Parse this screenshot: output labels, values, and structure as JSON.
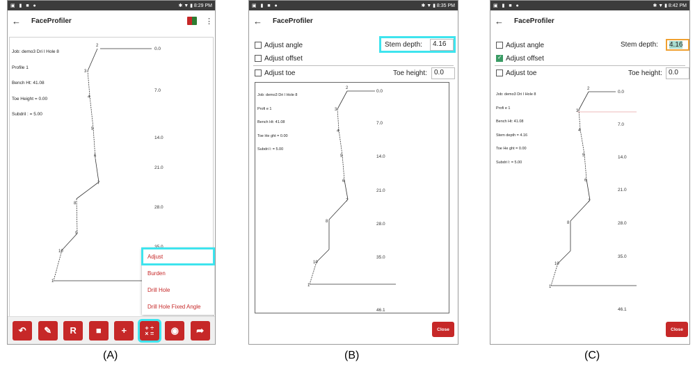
{
  "panels": [
    {
      "id": "A",
      "caption": "(A)",
      "status_time": "8:29 PM",
      "app_title": "FaceProfiler",
      "info_lines": [
        "Job: demo3 Dri l Hole 8",
        "Profile 1",
        "Bench Ht: 41.08",
        "Toe Height = 0.00",
        "Subdril : = 5.00"
      ],
      "depth_labels": [
        "0.0",
        "7.0",
        "14.0",
        "21.0",
        "28.0",
        "35.0"
      ],
      "point_labels": [
        "2",
        "3",
        "4",
        "5",
        "6",
        "7",
        "8",
        "9",
        "10",
        "1"
      ],
      "menu_items": [
        "Adjust",
        "Burden",
        "Drill Hole",
        "Drill Hole Fixed Angle"
      ],
      "toolbar": [
        "undo",
        "pencil",
        "R",
        "trash",
        "plus",
        "calculator",
        "camera",
        "share"
      ]
    },
    {
      "id": "B",
      "caption": "(B)",
      "status_time": "8:35 PM",
      "app_title": "FaceProfiler",
      "adjust_angle": "Adjust angle",
      "adjust_offset": "Adjust offset",
      "adjust_toe": "Adjust toe",
      "stem_depth_label": "Stem depth:",
      "stem_depth_value": "4.16",
      "toe_height_label": "Toe height:",
      "toe_height_value": "0.0",
      "offset_checked": false,
      "info_lines": [
        "Job: demo3 Dri l Hole 8",
        "Profi e 1",
        "Bench Ht: 41.08",
        "Toe He ght = 0.00",
        "Subdri l: = 5.00"
      ],
      "depth_labels": [
        "0.0",
        "7.0",
        "14.0",
        "21.0",
        "28.0",
        "35.0",
        "46.1"
      ],
      "close_label": "Close"
    },
    {
      "id": "C",
      "caption": "(C)",
      "status_time": "8:42 PM",
      "app_title": "FaceProfiler",
      "adjust_angle": "Adjust angle",
      "adjust_offset": "Adjust offset",
      "adjust_toe": "Adjust toe",
      "stem_depth_label": "Stem depth:",
      "stem_depth_value": "4.16",
      "toe_height_label": "Toe height:",
      "toe_height_value": "0.0",
      "offset_checked": true,
      "info_lines": [
        "Job: demo3 Dri l Hole 8",
        "Profi e 1",
        "Bench Ht: 41.08",
        "Stem depth = 4.16",
        "Toe He ght = 0.00",
        "Subdri l: = 5.00"
      ],
      "depth_labels": [
        "0.0",
        "7.0",
        "14.0",
        "21.0",
        "28.0",
        "35.0",
        "46.1"
      ],
      "close_label": "Close"
    }
  ]
}
